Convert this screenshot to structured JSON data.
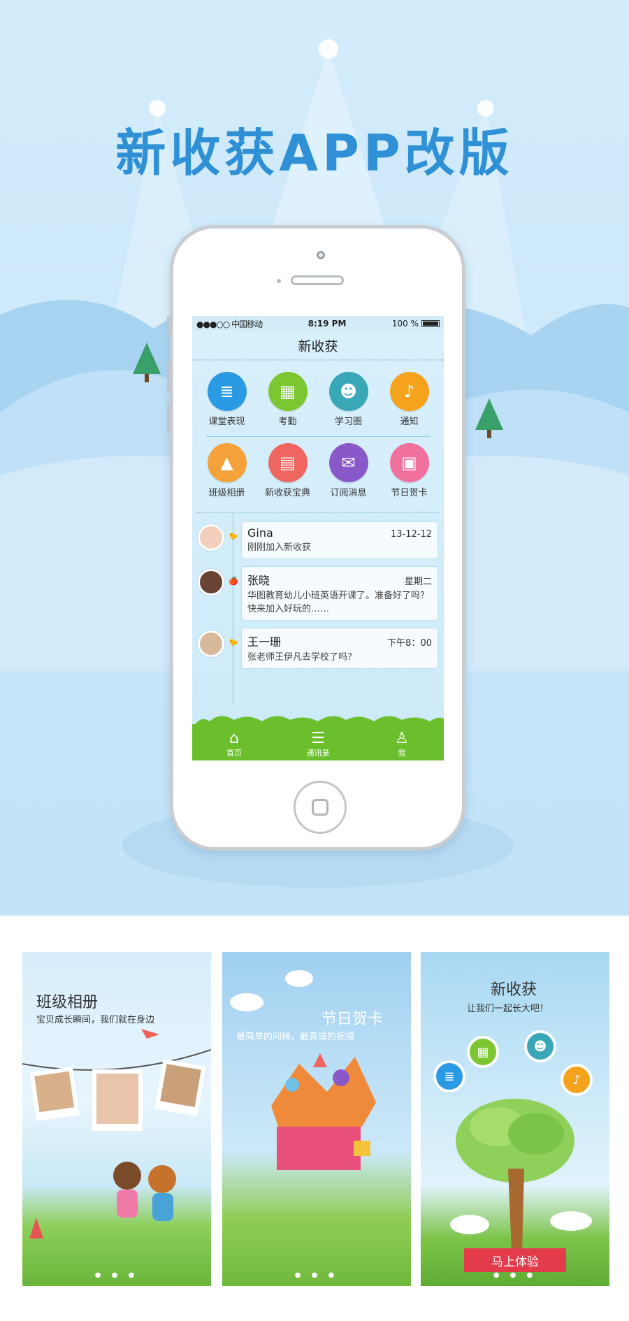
{
  "hero": {
    "title": "新收获APP改版"
  },
  "status_bar": {
    "carrier": "●●●○○ 中国移动",
    "time": "8:19 PM",
    "battery": "100 %"
  },
  "nav": {
    "title": "新收获"
  },
  "grid": [
    {
      "label": "课堂表现",
      "icon": "list-icon",
      "color": "#2b9ae5",
      "glyph": "≣"
    },
    {
      "label": "考勤",
      "icon": "calendar-icon",
      "color": "#7cc631",
      "glyph": "▦"
    },
    {
      "label": "学习圈",
      "icon": "group-icon",
      "color": "#3aa7b7",
      "glyph": "☻"
    },
    {
      "label": "通知",
      "icon": "bell-icon",
      "color": "#f5a21c",
      "glyph": "♪"
    },
    {
      "label": "班级相册",
      "icon": "photo-icon",
      "color": "#f5a23b",
      "glyph": "▲"
    },
    {
      "label": "新收获宝典",
      "icon": "book-icon",
      "color": "#ef6560",
      "glyph": "▤"
    },
    {
      "label": "订阅消息",
      "icon": "chat-icon",
      "color": "#8a59c9",
      "glyph": "✉"
    },
    {
      "label": "节日贺卡",
      "icon": "card-icon",
      "color": "#f0709e",
      "glyph": "▣"
    }
  ],
  "messages": [
    {
      "name": "Gina",
      "date": "13-12-12",
      "text": "刚刚加入新收获",
      "marker": "🐤",
      "avatar_color": "#f3d0bd"
    },
    {
      "name": "张晓",
      "date": "星期二",
      "text": "华图教育幼儿小班英语开课了。准备好了吗？快来加入好玩的……",
      "marker": "🍎",
      "avatar_color": "#6a4334"
    },
    {
      "name": "王一珊",
      "date": "下午8：00",
      "text": "张老师王伊凡去学校了吗？",
      "marker": "🐤",
      "avatar_color": "#d6b99a"
    }
  ],
  "tabs": [
    {
      "label": "首页",
      "icon": "home-icon",
      "glyph": "⌂"
    },
    {
      "label": "通讯录",
      "icon": "contacts-icon",
      "glyph": "☰"
    },
    {
      "label": "我",
      "icon": "user-icon",
      "glyph": "♙"
    }
  ],
  "previews": [
    {
      "title": "班级相册",
      "subtitle": "宝贝成长瞬间，我们就在身边"
    },
    {
      "title": "节日贺卡",
      "subtitle": "最简单的问候，最真诚的祝福"
    },
    {
      "title": "新收获",
      "subtitle": "让我们一起长大吧！",
      "button": "马上体验"
    }
  ],
  "colors": {
    "accent": "#2f90d6",
    "grass": "#6bbf2c",
    "button": "#e33b4a"
  }
}
